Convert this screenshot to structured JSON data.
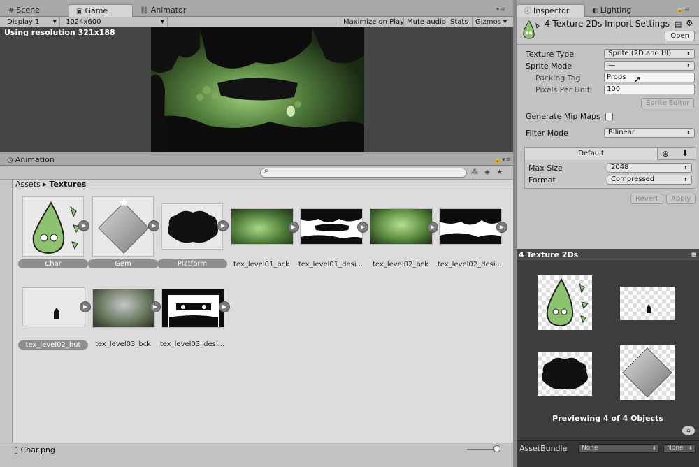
{
  "left_tabs": {
    "scene": "Scene",
    "game": "Game",
    "animator": "Animator"
  },
  "right_tabs": {
    "inspector": "Inspector",
    "lighting": "Lighting"
  },
  "game_toolbar": {
    "display": "Display 1",
    "resolution": "1024x600",
    "maximize": "Maximize on Play",
    "mute": "Mute audio",
    "stats": "Stats",
    "gizmos": "Gizmos"
  },
  "game_view": {
    "resolution_message": "Using resolution 321x188"
  },
  "animation_panel": {
    "title": "Animation"
  },
  "project": {
    "breadcrumb": {
      "root": "Assets",
      "folder": "Textures"
    },
    "assets": [
      {
        "name": "Char",
        "selected": true
      },
      {
        "name": "Gem",
        "selected": true
      },
      {
        "name": "Platform",
        "selected": true
      },
      {
        "name": "tex_level01_bck",
        "selected": false
      },
      {
        "name": "tex_level01_desi...",
        "selected": false
      },
      {
        "name": "tex_level02_bck",
        "selected": false
      },
      {
        "name": "tex_level02_desi...",
        "selected": false
      },
      {
        "name": "tex_level02_hut",
        "selected": true
      },
      {
        "name": "tex_level03_bck",
        "selected": false
      },
      {
        "name": "tex_level03_desi...",
        "selected": false
      }
    ],
    "footer_file": "Char.png"
  },
  "inspector": {
    "title": "4 Texture 2Ds Import Settings",
    "open_button": "Open",
    "texture_type_label": "Texture Type",
    "texture_type_value": "Sprite (2D and UI)",
    "sprite_mode_label": "Sprite Mode",
    "sprite_mode_value": "—",
    "packing_tag_label": "Packing Tag",
    "packing_tag_value": "Props",
    "ppu_label": "Pixels Per Unit",
    "ppu_value": "100",
    "sprite_editor_button": "Sprite Editor",
    "mipmaps_label": "Generate Mip Maps",
    "mipmaps_checked": false,
    "filter_label": "Filter Mode",
    "filter_value": "Bilinear",
    "platform_default": "Default",
    "max_size_label": "Max Size",
    "max_size_value": "2048",
    "format_label": "Format",
    "format_value": "Compressed",
    "revert_button": "Revert",
    "apply_button": "Apply"
  },
  "preview": {
    "title": "4 Texture 2Ds",
    "message": "Previewing 4 of 4 Objects",
    "assetbundle_label": "AssetBundle",
    "assetbundle_value": "None",
    "assetbundle_variant": "None"
  },
  "colors": {
    "selection_pill": "#8e8e8e",
    "panel_bg": "#c2c2c2",
    "accent_green": "#8dc26f"
  }
}
